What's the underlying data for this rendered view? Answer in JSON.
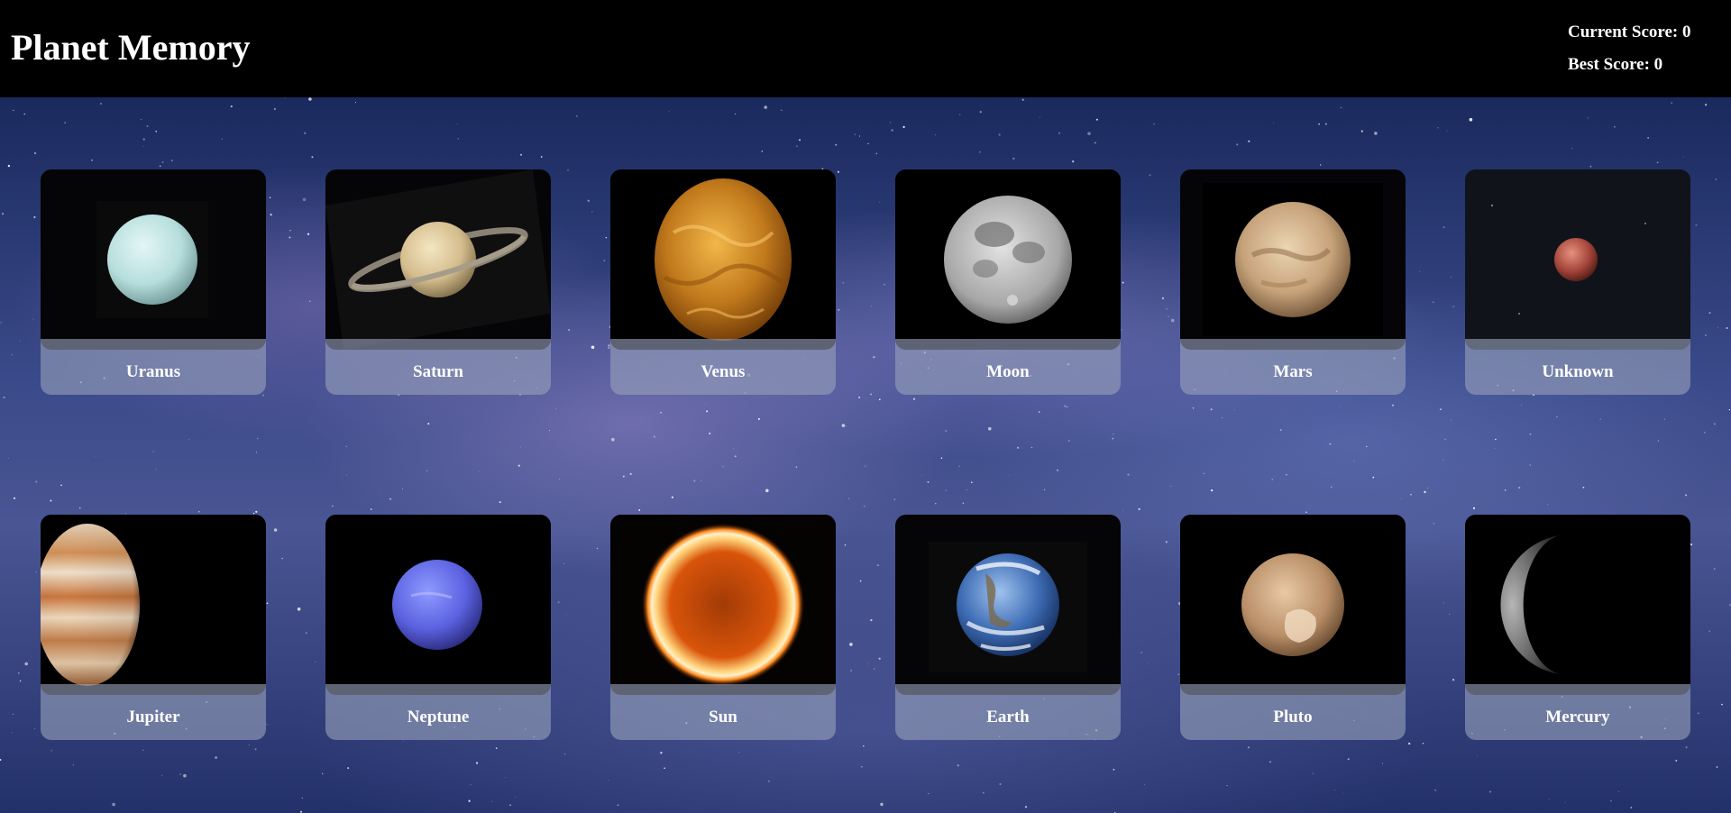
{
  "header": {
    "title": "Planet Memory",
    "current_score_label": "Current Score: 0",
    "best_score_label": "Best Score: 0"
  },
  "game": {
    "current_score": 0,
    "best_score": 0
  },
  "cards": [
    {
      "name": "Uranus",
      "icon": "uranus-icon"
    },
    {
      "name": "Saturn",
      "icon": "saturn-icon"
    },
    {
      "name": "Venus",
      "icon": "venus-icon"
    },
    {
      "name": "Moon",
      "icon": "moon-icon"
    },
    {
      "name": "Mars",
      "icon": "mars-icon"
    },
    {
      "name": "Unknown",
      "icon": "unknown-planet-icon"
    },
    {
      "name": "Jupiter",
      "icon": "jupiter-icon"
    },
    {
      "name": "Neptune",
      "icon": "neptune-icon"
    },
    {
      "name": "Sun",
      "icon": "sun-icon"
    },
    {
      "name": "Earth",
      "icon": "earth-icon"
    },
    {
      "name": "Pluto",
      "icon": "pluto-icon"
    },
    {
      "name": "Mercury",
      "icon": "mercury-icon"
    }
  ],
  "colors": {
    "header_bg": "#000000",
    "text": "#ffffff",
    "card_bg": "#050507",
    "label_bar": "#96a0b9"
  }
}
